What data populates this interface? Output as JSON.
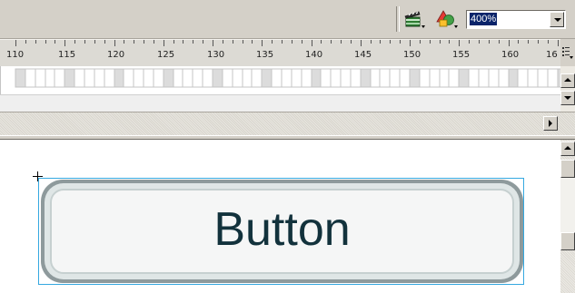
{
  "toolbar": {
    "edit_scene_icon": "clapperboard-icon",
    "edit_symbols_icon": "shapes-icon",
    "zoom": {
      "value": "400%",
      "icon": "chevron-down-icon"
    }
  },
  "timeline": {
    "ruler_labels": [
      "110",
      "115",
      "120",
      "125",
      "130",
      "135",
      "140",
      "145",
      "150",
      "155",
      "160",
      "16"
    ],
    "frame_view_icon": "frame-view-menu-icon"
  },
  "stage": {
    "button_label": "Button"
  }
}
